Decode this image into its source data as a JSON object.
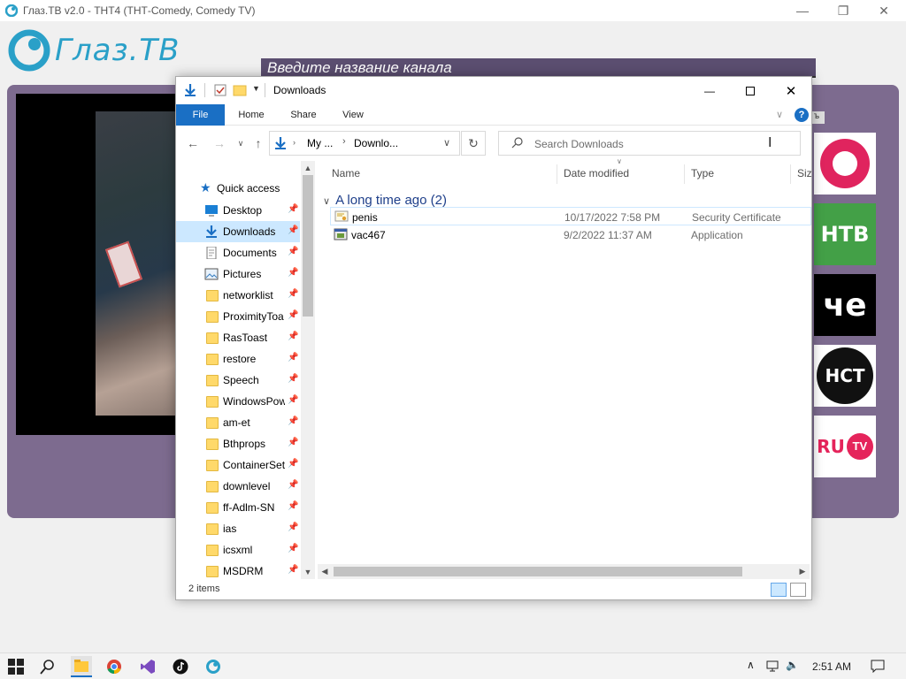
{
  "background_app": {
    "title": "Глаз.ТВ v2.0 - ТНТ4 (ТНТ-Comedy, Comedy TV)",
    "logo_text": "Глаз.ТВ",
    "channel_search_placeholder": "Введите название канала",
    "small_tab": "ъ",
    "channels": [
      {
        "name": "Домашний",
        "label": "",
        "bg": "#ffffff",
        "fg": "#e0245e"
      },
      {
        "name": "НТВ",
        "label": "НТВ",
        "bg": "#43a047",
        "fg": "#ffffff"
      },
      {
        "name": "ЧЕ",
        "label": "че",
        "bg": "#000000",
        "fg": "#ffffff"
      },
      {
        "name": "НСТ",
        "label": "НСТ",
        "bg": "#ffffff",
        "fg": "#ffffff"
      },
      {
        "name": "RU TV",
        "label": "RU",
        "bg": "#ffffff",
        "fg": "#e5245b"
      }
    ],
    "ru_tv_badge": "TV"
  },
  "explorer": {
    "title": "Downloads",
    "ribbon_tabs": [
      "File",
      "Home",
      "Share",
      "View"
    ],
    "help_label": "?",
    "breadcrumb": [
      "My ...",
      "Downlo..."
    ],
    "search_placeholder": "Search Downloads",
    "nav": {
      "quick_access": "Quick access",
      "items": [
        {
          "label": "Desktop",
          "icon": "desktop-icon",
          "pinned": true,
          "selected": false
        },
        {
          "label": "Downloads",
          "icon": "downloads-icon",
          "pinned": true,
          "selected": true
        },
        {
          "label": "Documents",
          "icon": "documents-icon",
          "pinned": true,
          "selected": false
        },
        {
          "label": "Pictures",
          "icon": "pictures-icon",
          "pinned": true,
          "selected": false
        },
        {
          "label": "networklist",
          "icon": "folder-icon",
          "pinned": true,
          "selected": false
        },
        {
          "label": "ProximityToa",
          "icon": "folder-icon",
          "pinned": true,
          "selected": false
        },
        {
          "label": "RasToast",
          "icon": "folder-icon",
          "pinned": true,
          "selected": false
        },
        {
          "label": "restore",
          "icon": "folder-icon",
          "pinned": true,
          "selected": false
        },
        {
          "label": "Speech",
          "icon": "folder-icon",
          "pinned": true,
          "selected": false
        },
        {
          "label": "WindowsPow",
          "icon": "folder-icon",
          "pinned": true,
          "selected": false
        },
        {
          "label": "am-et",
          "icon": "folder-icon",
          "pinned": true,
          "selected": false
        },
        {
          "label": "Bthprops",
          "icon": "folder-icon",
          "pinned": true,
          "selected": false
        },
        {
          "label": "ContainerSett",
          "icon": "folder-icon",
          "pinned": true,
          "selected": false
        },
        {
          "label": "downlevel",
          "icon": "folder-icon",
          "pinned": true,
          "selected": false
        },
        {
          "label": "ff-Adlm-SN",
          "icon": "folder-icon",
          "pinned": true,
          "selected": false
        },
        {
          "label": "ias",
          "icon": "folder-icon",
          "pinned": true,
          "selected": false
        },
        {
          "label": "icsxml",
          "icon": "folder-icon",
          "pinned": true,
          "selected": false
        },
        {
          "label": "MSDRM",
          "icon": "folder-icon",
          "pinned": true,
          "selected": false
        }
      ]
    },
    "columns": [
      "Name",
      "Date modified",
      "Type",
      "Siz"
    ],
    "group_label": "A long time ago (2)",
    "files": [
      {
        "name": "penis",
        "date": "10/17/2022 7:58 PM",
        "type": "Security Certificate",
        "icon": "certificate-icon"
      },
      {
        "name": "vac467",
        "date": "9/2/2022 11:37 AM",
        "type": "Application",
        "icon": "application-icon"
      }
    ],
    "status_items": "2 items"
  },
  "taskbar": {
    "apps": [
      "start",
      "search",
      "file-explorer",
      "chrome",
      "visual-studio",
      "tiktok",
      "glaz-tv"
    ],
    "clock": "2:51 AM"
  }
}
